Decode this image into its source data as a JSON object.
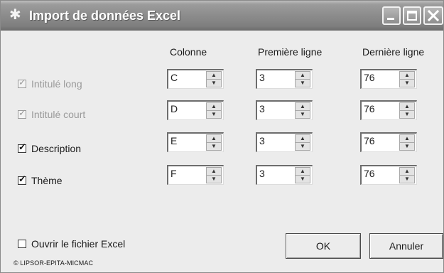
{
  "window": {
    "title": "Import de données Excel"
  },
  "columns": {
    "col1": "Colonne",
    "col2": "Première ligne",
    "col3": "Dernière ligne"
  },
  "rows": [
    {
      "label": "Intitulé long",
      "checked": true,
      "enabled": false,
      "colonne": "C",
      "premiere": "3",
      "derniere": "76"
    },
    {
      "label": "Intitulé court",
      "checked": true,
      "enabled": false,
      "colonne": "D",
      "premiere": "3",
      "derniere": "76"
    },
    {
      "label": "Description",
      "checked": true,
      "enabled": true,
      "colonne": "E",
      "premiere": "3",
      "derniere": "76"
    },
    {
      "label": "Thème",
      "checked": true,
      "enabled": true,
      "colonne": "F",
      "premiere": "3",
      "derniere": "76"
    }
  ],
  "open_excel": {
    "label": "Ouvrir le fichier Excel",
    "checked": false
  },
  "buttons": {
    "ok": "OK",
    "cancel": "Annuler"
  },
  "footer": "© LIPSOR-EPITA-MICMAC",
  "icons": {
    "app": "app-star-icon",
    "minimize": "minimize-icon",
    "maximize": "maximize-icon",
    "close": "close-icon"
  },
  "colors": {
    "titlebar": "#8c8c8c",
    "window_bg": "#ececec"
  }
}
